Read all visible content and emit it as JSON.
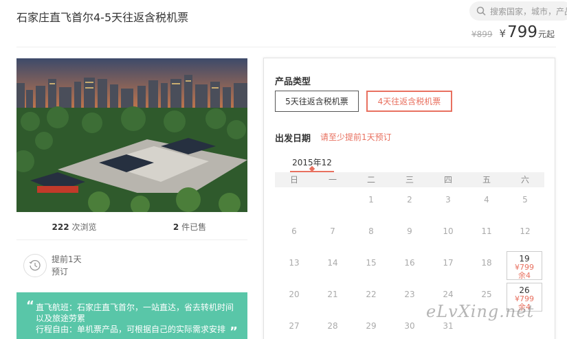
{
  "header": {
    "title": "石家庄直飞首尔4-5天往返含税机票",
    "search_placeholder": "搜索国家，城市，产品",
    "old_price": "¥899",
    "currency": "¥",
    "price": "799",
    "price_unit": "元起"
  },
  "stats": {
    "views_count": "222",
    "views_label": "次浏览",
    "sold_count": "2",
    "sold_label": "件已售"
  },
  "advance": {
    "line1": "提前1天",
    "line2": "预订"
  },
  "highlights": {
    "line1": "直飞航班：石家庄直飞首尔，一站直达，省去转机时间以及旅途劳累",
    "line2": "行程自由：单机票产品，可根据自己的实际需求安排"
  },
  "booking": {
    "product_type_label": "产品类型",
    "options": [
      "5天往返含税机票",
      "4天往返含税机票"
    ],
    "selected_option": 1,
    "date_label": "出发日期",
    "date_hint": "请至少提前1天预订",
    "month": "2015年12",
    "weekdays": [
      "日",
      "一",
      "二",
      "三",
      "四",
      "五",
      "六"
    ],
    "days": [
      [
        "",
        "",
        "1",
        "2",
        "3",
        "4",
        "5"
      ],
      [
        "6",
        "7",
        "8",
        "9",
        "10",
        "11",
        "12"
      ],
      [
        "13",
        "14",
        "15",
        "16",
        "17",
        "18",
        "19"
      ],
      [
        "20",
        "21",
        "22",
        "23",
        "24",
        "25",
        "26"
      ],
      [
        "27",
        "28",
        "29",
        "30",
        "31",
        "",
        ""
      ]
    ],
    "available": [
      {
        "day": "19",
        "price": "¥799",
        "remain": "余4"
      },
      {
        "day": "26",
        "price": "¥799",
        "remain": "余4"
      }
    ]
  },
  "watermark": "eLvXing.net",
  "colors": {
    "accent": "#e8705f",
    "green": "#59c6a8"
  }
}
